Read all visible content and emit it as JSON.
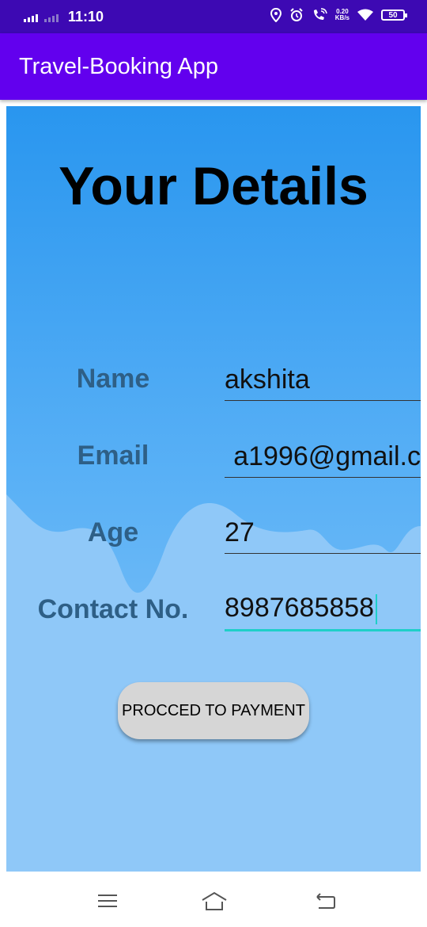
{
  "status_bar": {
    "time": "11:10",
    "net_speed_value": "0.20",
    "net_speed_unit": "KB/s",
    "battery": "50"
  },
  "app_bar": {
    "title": "Travel-Booking App"
  },
  "form": {
    "heading": "Your Details",
    "fields": [
      {
        "label": "Name",
        "value": "akshita"
      },
      {
        "label": "Email",
        "value": "a1996@gmail.c"
      },
      {
        "label": "Age",
        "value": "27"
      },
      {
        "label": "Contact No.",
        "value": "8987685858"
      }
    ],
    "submit_label": "PROCCED TO PAYMENT"
  },
  "colors": {
    "app_bar": "#6200ee",
    "status_bar": "#3d09b3",
    "label": "#2e5f86",
    "focus": "#1fcfc8"
  },
  "nav_bar": {
    "icons": [
      "menu-icon",
      "home-icon",
      "back-icon"
    ]
  }
}
